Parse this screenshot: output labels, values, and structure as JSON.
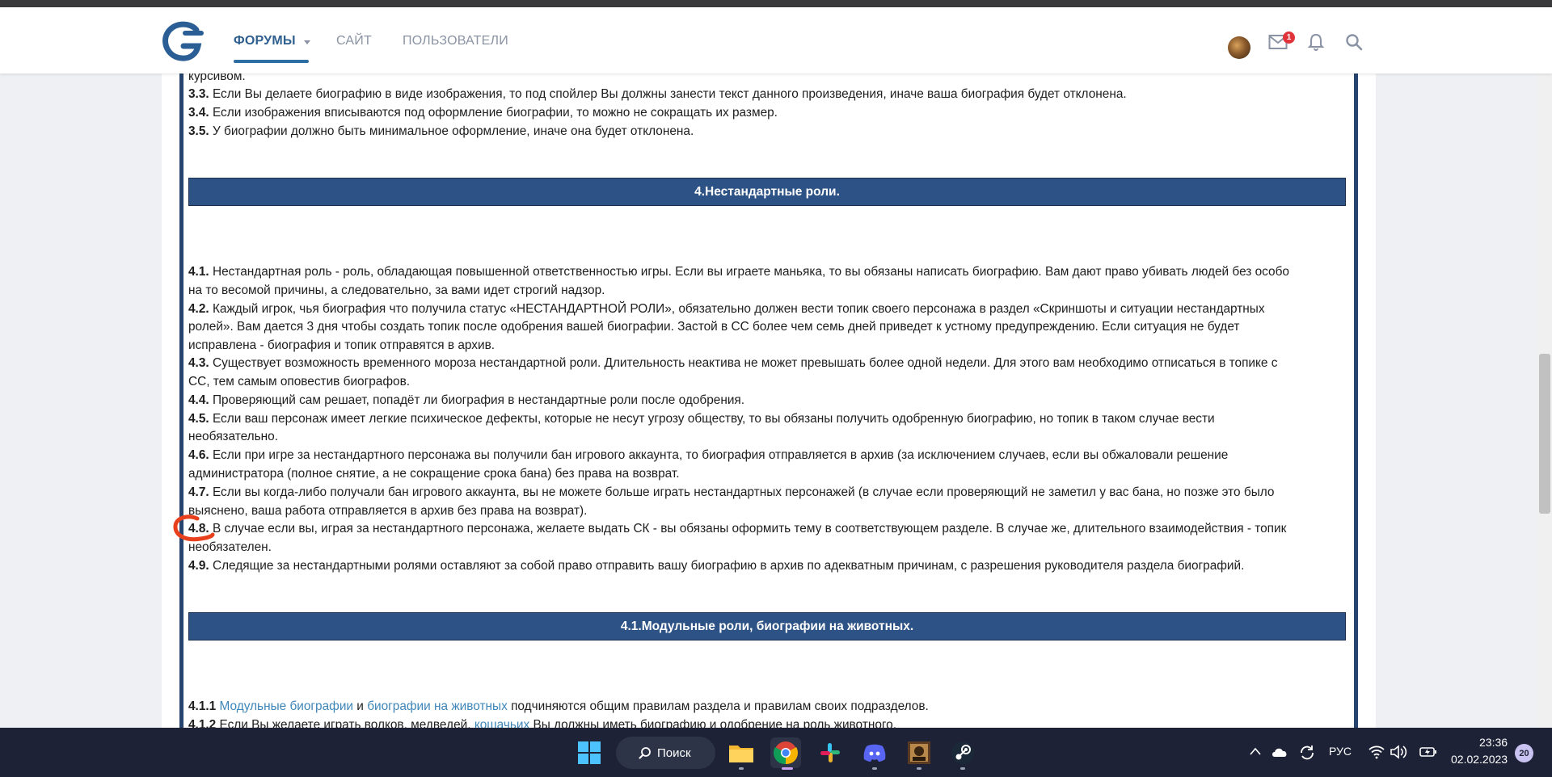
{
  "nav": {
    "tabs": [
      {
        "label": "ФОРУМЫ",
        "active": true
      },
      {
        "label": "САЙТ",
        "active": false
      },
      {
        "label": "ПОЛЬЗОВАТЕЛИ",
        "active": false
      }
    ],
    "mail_badge": "1",
    "icons": [
      "moon-icon",
      "avatar",
      "mail-icon",
      "bell-icon",
      "search-icon"
    ]
  },
  "content": {
    "top_lines": [
      {
        "num": "",
        "text": "курсивом."
      },
      {
        "num": "3.3.",
        "text": " Если Вы делаете биографию в виде изображения, то под спойлер Вы должны занести текст данного произведения, иначе ваша биография будет отклонена."
      },
      {
        "num": "3.4.",
        "text": " Если изображения вписываются под оформление биографии, то можно не сокращать их размер."
      },
      {
        "num": "3.5.",
        "text": " У биографии должно быть минимальное оформление, иначе она будет отклонена."
      }
    ],
    "section4_title": "4.Нестандартные роли.",
    "section4_lines": [
      {
        "num": "4.1.",
        "text": " Нестандартная роль - роль, обладающая повышенной ответственностью игры. Если вы играете маньяка, то вы обязаны написать биографию. Вам дают право убивать людей без особо"
      },
      {
        "num": "",
        "text": "на то весомой причины, а следовательно, за вами идет строгий надзор."
      },
      {
        "num": "4.2.",
        "text": " Каждый игрок, чья биография что получила статус «НЕСТАНДАРТНОЙ РОЛИ», обязательно должен вести топик своего персонажа в раздел «Скриншоты и ситуации нестандартных"
      },
      {
        "num": "",
        "text": "ролей». Вам дается 3 дня чтобы создать топик после одобрения вашей биографии. Застой в СС более чем семь дней приведет к устному предупреждению. Если ситуация не будет"
      },
      {
        "num": "",
        "text": "исправлена - биография и топик отправятся в архив."
      },
      {
        "num": "4.3.",
        "text": " Существует возможность временного мороза нестандартной роли. Длительность неактива не может превышать более одной недели. Для этого вам необходимо отписаться в топике с"
      },
      {
        "num": "",
        "text": "СС, тем самым оповестив биографов."
      },
      {
        "num": "4.4.",
        "text": " Проверяющий сам решает, попадёт ли биография в нестандартные роли после одобрения."
      },
      {
        "num": "4.5.",
        "text": " Если ваш персонаж имеет легкие психическое дефекты, которые не несут угрозу обществу, то вы обязаны получить одобренную биографию, но топик в таком случае вести"
      },
      {
        "num": "",
        "text": "необязательно."
      },
      {
        "num": "4.6.",
        "text": " Если при игре за нестандартного персонажа вы получили бан игрового аккаунта, то биография отправляется в архив (за исключением случаев, если вы обжаловали решение"
      },
      {
        "num": "",
        "text": "администратора (полное снятие, а не сокращение срока бана) без права на возврат."
      },
      {
        "num": "4.7.",
        "text": " Если вы когда-либо получали бан игрового аккаунта, вы не можете больше играть нестандартных персонажей (в случае если проверяющий не заметил у вас бана, но позже это было"
      },
      {
        "num": "",
        "text": "выяснено, ваша работа отправляется в архив без права на возврат)."
      },
      {
        "num": "4.8.",
        "text": " В случае если вы, играя за нестандартного персонажа, желаете выдать СК - вы обязаны оформить тему в соответствующем разделе. В случае же, длительного взаимодействия - топик"
      },
      {
        "num": "",
        "text": "необязателен."
      },
      {
        "num": "4.9.",
        "text": " Следящие за нестандартными ролями оставляют за собой право отправить вашу биографию в архив по адекватным причинам, с разрешения руководителя раздела биографий."
      }
    ],
    "section41_title": "4.1.Модульные роли, биографии на животных.",
    "line_411": {
      "num": "4.1.1",
      "link1": "Модульные биографии",
      "mid": " и ",
      "link2": "биографии на животных",
      "tail": " подчиняются общим правилам раздела и правилам своих подразделов."
    },
    "line_412": {
      "num": "4.1.2",
      "pre": " Если Вы желаете играть волков, медведей, ",
      "link": "кошачьих",
      "tail": " Вы должны иметь биографию и одобрение на роль животного."
    }
  },
  "taskbar": {
    "search_label": "Поиск",
    "apps": [
      "windows-start-icon",
      "file-explorer-icon",
      "chrome-icon",
      "slack-icon",
      "discord-icon",
      "game-app-icon",
      "steam-icon"
    ],
    "language": "РУС",
    "time": "23:36",
    "date": "02.02.2023",
    "notification_count": "20"
  },
  "colors": {
    "section_bar": "#2d5285",
    "content_border": "#27446e",
    "nav_active": "#2f5f8f",
    "link": "#3f86b8",
    "taskbar": "#1d2236"
  }
}
